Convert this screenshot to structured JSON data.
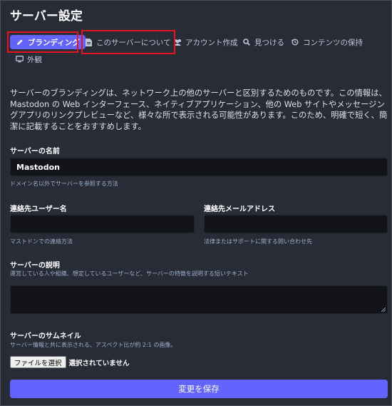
{
  "page": {
    "title": "サーバー設定"
  },
  "tabs": [
    {
      "label": "ブランディング",
      "icon": "pencil-icon",
      "active": true
    },
    {
      "label": "このサーバーについて",
      "icon": "file-icon"
    },
    {
      "label": "アカウント作成",
      "icon": "users-icon"
    },
    {
      "label": "見つける",
      "icon": "search-icon"
    },
    {
      "label": "コンテンツの保持",
      "icon": "history-icon"
    },
    {
      "label": "外観",
      "icon": "desktop-icon"
    }
  ],
  "intro": "サーバーのブランディングは、ネットワーク上の他のサーバーと区別するためのものです。この情報は、Mastodon の Web インターフェース、ネイティブアプリケーション、他の Web サイトやメッセージングアプリのリンクプレビューなど、様々な所で表示される可能性があります。このため、明確で短く、簡潔に記載することをおすすめします。",
  "form": {
    "server_name": {
      "label": "サーバーの名前",
      "value": "Mastodon",
      "hint": "ドメイン名以外でサーバーを参照する方法"
    },
    "contact_username": {
      "label": "連絡先ユーザー名",
      "value": "",
      "hint": "マストドンでの連絡方法"
    },
    "contact_email": {
      "label": "連絡先メールアドレス",
      "value": "",
      "hint": "法律またはサポートに関する問い合わせ先"
    },
    "description": {
      "label": "サーバーの説明",
      "hint": "運営している人や組織、想定しているユーザーなど、サーバーの特徴を説明する短いテキスト",
      "value": ""
    },
    "thumbnail": {
      "label": "サーバーのサムネイル",
      "hint": "サーバー情報と共に表示される、アスペクト比が約 2:1 の画像。",
      "button": "ファイルを選択",
      "status": "選択されていません"
    },
    "submit": "変更を保存"
  },
  "colors": {
    "accent": "#6364ff",
    "background": "#282c37",
    "input": "#131419",
    "highlight": "#e8141c"
  }
}
